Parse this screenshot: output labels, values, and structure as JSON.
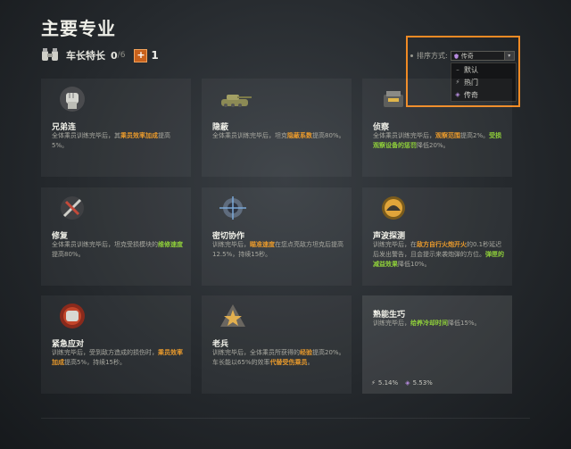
{
  "page": {
    "title": "主要专业"
  },
  "crew": {
    "label": "车长特长",
    "count": "0",
    "total": "/6",
    "plus_symbol": "+",
    "plus_value": "1"
  },
  "sort": {
    "label": "排序方式:",
    "selected": "传奇",
    "options": [
      {
        "label": "默认",
        "mark": "–"
      },
      {
        "label": "热门",
        "mark": "⚡"
      },
      {
        "label": "传奇",
        "mark": "◈"
      }
    ]
  },
  "cards": [
    {
      "name": "兄弟连",
      "icon": "fist-icon",
      "desc": [
        {
          "t": "全体乘员训练完毕后，其"
        },
        {
          "t": "乘员效率加成",
          "c": "orange"
        },
        {
          "t": "提高5%。"
        }
      ]
    },
    {
      "name": "隐蔽",
      "icon": "camouflage-tank-icon",
      "desc": [
        {
          "t": "全体乘员训练完毕后，坦克"
        },
        {
          "t": "隐蔽系数",
          "c": "orange"
        },
        {
          "t": "提高80%。"
        }
      ]
    },
    {
      "name": "侦察",
      "icon": "periscope-icon",
      "desc": [
        {
          "t": "全体乘员训练完毕后，"
        },
        {
          "t": "观察范围",
          "c": "orange"
        },
        {
          "t": "提高2%。"
        },
        {
          "t": "受损观察设备的惩罚",
          "c": "green"
        },
        {
          "t": "降低20%。"
        }
      ]
    },
    {
      "name": "修复",
      "icon": "wrench-icon",
      "desc": [
        {
          "t": "全体乘员训练完毕后，坦克受损模块的"
        },
        {
          "t": "维修速度",
          "c": "green"
        },
        {
          "t": "提高80%。"
        }
      ]
    },
    {
      "name": "密切协作",
      "icon": "crosshair-icon",
      "desc": [
        {
          "t": "训练完毕后，"
        },
        {
          "t": "瞄准速度",
          "c": "orange"
        },
        {
          "t": "在您点亮敌方坦克后提高12.5%，持续15秒。"
        }
      ]
    },
    {
      "name": "声波探测",
      "icon": "radar-icon",
      "desc": [
        {
          "t": "训练完毕后，在"
        },
        {
          "t": "敌方自行火炮开火",
          "c": "orange"
        },
        {
          "t": "的0.1秒延迟后发出警告，且会提示来袭炮弹的方位。"
        },
        {
          "t": "弹匣的减益效果",
          "c": "green"
        },
        {
          "t": "降低10%。"
        }
      ]
    },
    {
      "name": "紧急应对",
      "icon": "burst-fist-icon",
      "desc": [
        {
          "t": "训练完毕后，受到敌方造成的损伤时，"
        },
        {
          "t": "乘员效率加成",
          "c": "orange"
        },
        {
          "t": "提高5%，持续15秒。"
        }
      ]
    },
    {
      "name": "老兵",
      "icon": "star-icon",
      "desc": [
        {
          "t": "训练完毕后，全体乘员所获得的"
        },
        {
          "t": "经验",
          "c": "orange"
        },
        {
          "t": "提高20%。车长能以65%的效率"
        },
        {
          "t": "代替受伤乘员",
          "c": "orange"
        },
        {
          "t": "。"
        }
      ]
    },
    {
      "name": "熟能生巧",
      "icon": "",
      "desc": [
        {
          "t": "训练完毕后，"
        },
        {
          "t": "给养冷却时间",
          "c": "green"
        },
        {
          "t": "降低15%。"
        }
      ],
      "stats": {
        "popular": "5.14%",
        "legendary": "5.53%"
      }
    }
  ],
  "colors": {
    "accent_orange": "#f08a24",
    "highlight_orange": "#e99a2c",
    "highlight_green": "#8fcf3a"
  }
}
